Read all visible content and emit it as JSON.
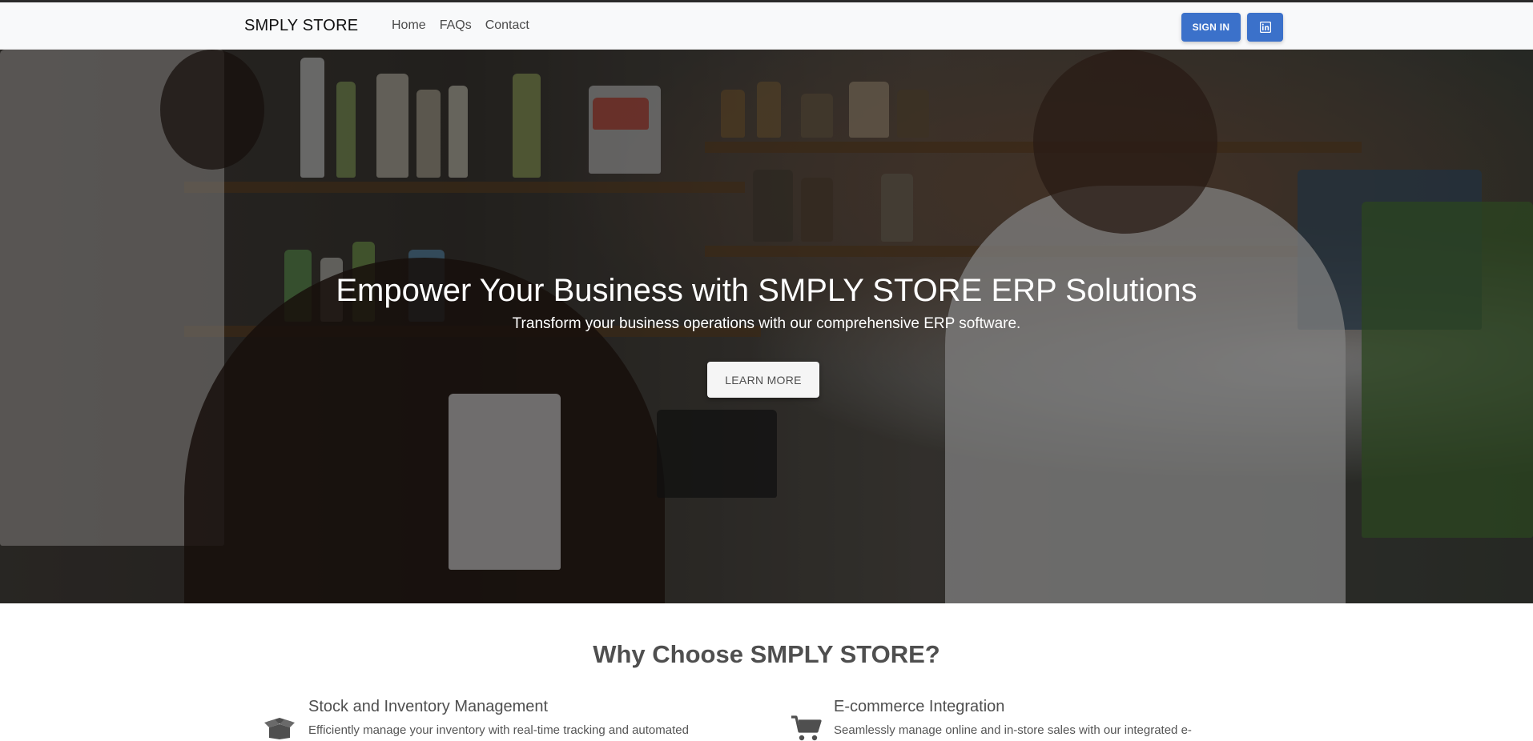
{
  "navbar": {
    "brand": "SMPLY STORE",
    "links": [
      "Home",
      "FAQs",
      "Contact"
    ],
    "signin_label": "SIGN IN",
    "linkedin_icon": "linkedin-icon",
    "accent_color": "#3b71ca"
  },
  "hero": {
    "title": "Empower Your Business with SMPLY STORE ERP Solutions",
    "subtitle": "Transform your business operations with our comprehensive ERP software.",
    "cta_label": "LEARN MORE"
  },
  "features_section": {
    "title": "Why Choose SMPLY STORE?",
    "items": [
      {
        "icon": "box-open-icon",
        "title": "Stock and Inventory Management",
        "description": "Efficiently manage your inventory with real-time tracking and automated"
      },
      {
        "icon": "shopping-cart-icon",
        "title": "E-commerce Integration",
        "description": "Seamlessly manage online and in-store sales with our integrated e-"
      }
    ]
  }
}
